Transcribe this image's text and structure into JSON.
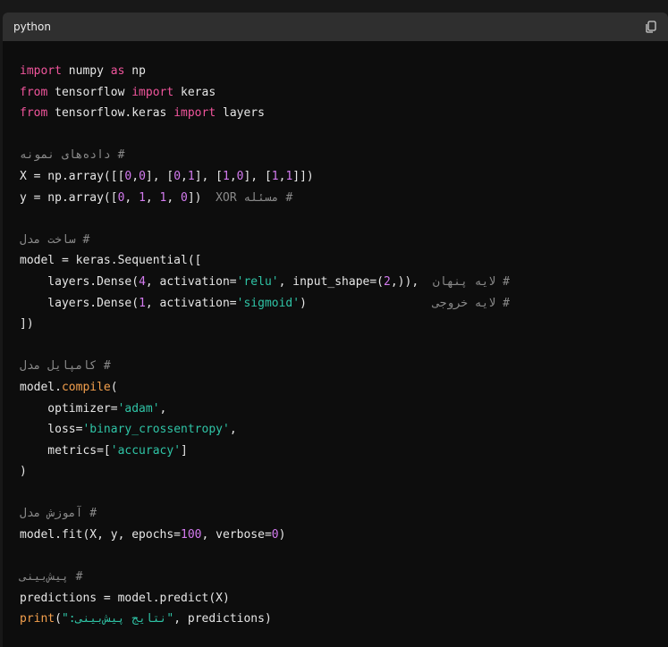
{
  "header": {
    "language": "python",
    "copy_icon": "copy-icon"
  },
  "colors": {
    "keyword": "#f0559c",
    "function": "#f4a04d",
    "number": "#d47bf0",
    "string": "#2fc4a6",
    "comment": "#8a8a8a",
    "text": "#e6e6e6"
  },
  "code_lines": [
    [
      [
        "kw",
        "import"
      ],
      [
        "t",
        " numpy "
      ],
      [
        "kw",
        "as"
      ],
      [
        "t",
        " np"
      ]
    ],
    [
      [
        "kw",
        "from"
      ],
      [
        "t",
        " tensorflow "
      ],
      [
        "kw",
        "import"
      ],
      [
        "t",
        " keras"
      ]
    ],
    [
      [
        "kw",
        "from"
      ],
      [
        "t",
        " tensorflow.keras "
      ],
      [
        "kw",
        "import"
      ],
      [
        "t",
        " layers"
      ]
    ],
    [],
    [
      [
        "cm",
        "# داده‌های نمونه"
      ]
    ],
    [
      [
        "t",
        "X = np.array([["
      ],
      [
        "num",
        "0"
      ],
      [
        "t",
        ","
      ],
      [
        "num",
        "0"
      ],
      [
        "t",
        "], ["
      ],
      [
        "num",
        "0"
      ],
      [
        "t",
        ","
      ],
      [
        "num",
        "1"
      ],
      [
        "t",
        "], ["
      ],
      [
        "num",
        "1"
      ],
      [
        "t",
        ","
      ],
      [
        "num",
        "0"
      ],
      [
        "t",
        "], ["
      ],
      [
        "num",
        "1"
      ],
      [
        "t",
        ","
      ],
      [
        "num",
        "1"
      ],
      [
        "t",
        "]])"
      ]
    ],
    [
      [
        "t",
        "y = np.array(["
      ],
      [
        "num",
        "0"
      ],
      [
        "t",
        ", "
      ],
      [
        "num",
        "1"
      ],
      [
        "t",
        ", "
      ],
      [
        "num",
        "1"
      ],
      [
        "t",
        ", "
      ],
      [
        "num",
        "0"
      ],
      [
        "t",
        "])  "
      ],
      [
        "cm",
        "# مسئله XOR"
      ]
    ],
    [],
    [
      [
        "cm",
        "# ساخت مدل"
      ]
    ],
    [
      [
        "t",
        "model = keras.Sequential(["
      ]
    ],
    [
      [
        "t",
        "    layers.Dense("
      ],
      [
        "num",
        "4"
      ],
      [
        "t",
        ", activation="
      ],
      [
        "str",
        "'relu'"
      ],
      [
        "t",
        ", input_shape=("
      ],
      [
        "num",
        "2"
      ],
      [
        "t",
        ",)),  "
      ],
      [
        "cm",
        "# لایه پنهان"
      ]
    ],
    [
      [
        "t",
        "    layers.Dense("
      ],
      [
        "num",
        "1"
      ],
      [
        "t",
        ", activation="
      ],
      [
        "str",
        "'sigmoid'"
      ],
      [
        "t",
        ")                  "
      ],
      [
        "cm",
        "# لایه خروجی"
      ]
    ],
    [
      [
        "t",
        "])"
      ]
    ],
    [],
    [
      [
        "cm",
        "# کامپایل مدل"
      ]
    ],
    [
      [
        "t",
        "model."
      ],
      [
        "fn",
        "compile"
      ],
      [
        "t",
        "("
      ]
    ],
    [
      [
        "t",
        "    optimizer="
      ],
      [
        "str",
        "'adam'"
      ],
      [
        "t",
        ","
      ]
    ],
    [
      [
        "t",
        "    loss="
      ],
      [
        "str",
        "'binary_crossentropy'"
      ],
      [
        "t",
        ","
      ]
    ],
    [
      [
        "t",
        "    metrics=["
      ],
      [
        "str",
        "'accuracy'"
      ],
      [
        "t",
        "]"
      ]
    ],
    [
      [
        "t",
        ")"
      ]
    ],
    [],
    [
      [
        "cm",
        "# آموزش مدل"
      ]
    ],
    [
      [
        "t",
        "model.fit(X, y, epochs="
      ],
      [
        "num",
        "100"
      ],
      [
        "t",
        ", verbose="
      ],
      [
        "num",
        "0"
      ],
      [
        "t",
        ")"
      ]
    ],
    [],
    [
      [
        "cm",
        "# پیش‌بینی"
      ]
    ],
    [
      [
        "t",
        "predictions = model.predict(X)"
      ]
    ],
    [
      [
        "fn",
        "print"
      ],
      [
        "t",
        "("
      ],
      [
        "str",
        "\"نتایج پیش‌بینی:\""
      ],
      [
        "t",
        ", predictions)"
      ]
    ]
  ]
}
